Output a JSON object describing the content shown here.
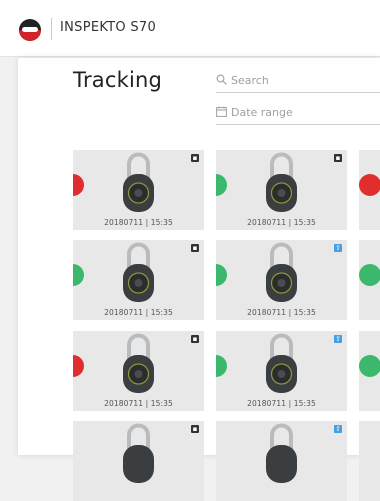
{
  "app": {
    "title": "INSPEKTO S70"
  },
  "page": {
    "title": "Tracking"
  },
  "search": {
    "placeholder": "Search"
  },
  "date_range": {
    "placeholder": "Date range"
  },
  "tiles": [
    {
      "caption": "20180711 | 15:35",
      "status": "red",
      "badge": "dark"
    },
    {
      "caption": "20180711 | 15:35",
      "status": "green",
      "badge": "dark"
    },
    {
      "caption": "20180711 | 15:35",
      "status": "green",
      "badge": "dark"
    },
    {
      "caption": "20180711 | 15:35",
      "status": "green",
      "badge": "blue"
    },
    {
      "caption": "20180711 | 15:35",
      "status": "red",
      "badge": "dark"
    },
    {
      "caption": "20180711 | 15:35",
      "status": "green",
      "badge": "blue"
    },
    {
      "caption": "",
      "status": "none",
      "badge": "dark"
    },
    {
      "caption": "",
      "status": "none",
      "badge": "blue"
    }
  ],
  "colors": {
    "fail": "#e02d2d",
    "pass": "#3bb86b",
    "badge_blue": "#46a0e0"
  },
  "icons": {
    "logo": "inspekto-logo",
    "search": "search-icon",
    "date": "calendar-icon"
  }
}
